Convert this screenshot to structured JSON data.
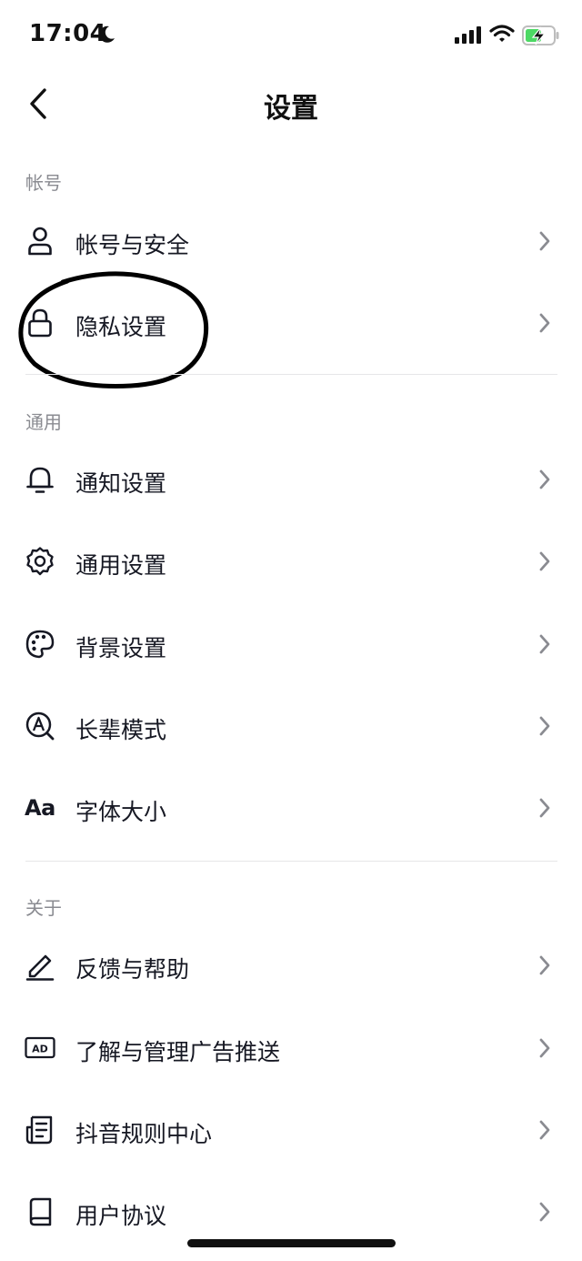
{
  "status_bar": {
    "time": "17:04"
  },
  "nav": {
    "title": "设置"
  },
  "sections": [
    {
      "header": "帐号",
      "items": [
        {
          "label": "帐号与安全",
          "icon": "user-icon"
        },
        {
          "label": "隐私设置",
          "icon": "lock-icon"
        }
      ]
    },
    {
      "header": "通用",
      "items": [
        {
          "label": "通知设置",
          "icon": "bell-icon"
        },
        {
          "label": "通用设置",
          "icon": "gear-icon"
        },
        {
          "label": "背景设置",
          "icon": "palette-icon"
        },
        {
          "label": "长辈模式",
          "icon": "elder-mode-icon"
        },
        {
          "label": "字体大小",
          "icon": "font-size-icon",
          "icon_text": "Aa"
        }
      ]
    },
    {
      "header": "关于",
      "items": [
        {
          "label": "反馈与帮助",
          "icon": "pencil-icon"
        },
        {
          "label": "了解与管理广告推送",
          "icon": "ad-icon",
          "icon_text": "AD"
        },
        {
          "label": "抖音规则中心",
          "icon": "document-icon"
        },
        {
          "label": "用户协议",
          "icon": "book-icon"
        }
      ]
    }
  ],
  "colors": {
    "text": "#161823",
    "section_header": "#8a8b91",
    "divider": "#e6e6e8",
    "battery": "#4cd964"
  }
}
